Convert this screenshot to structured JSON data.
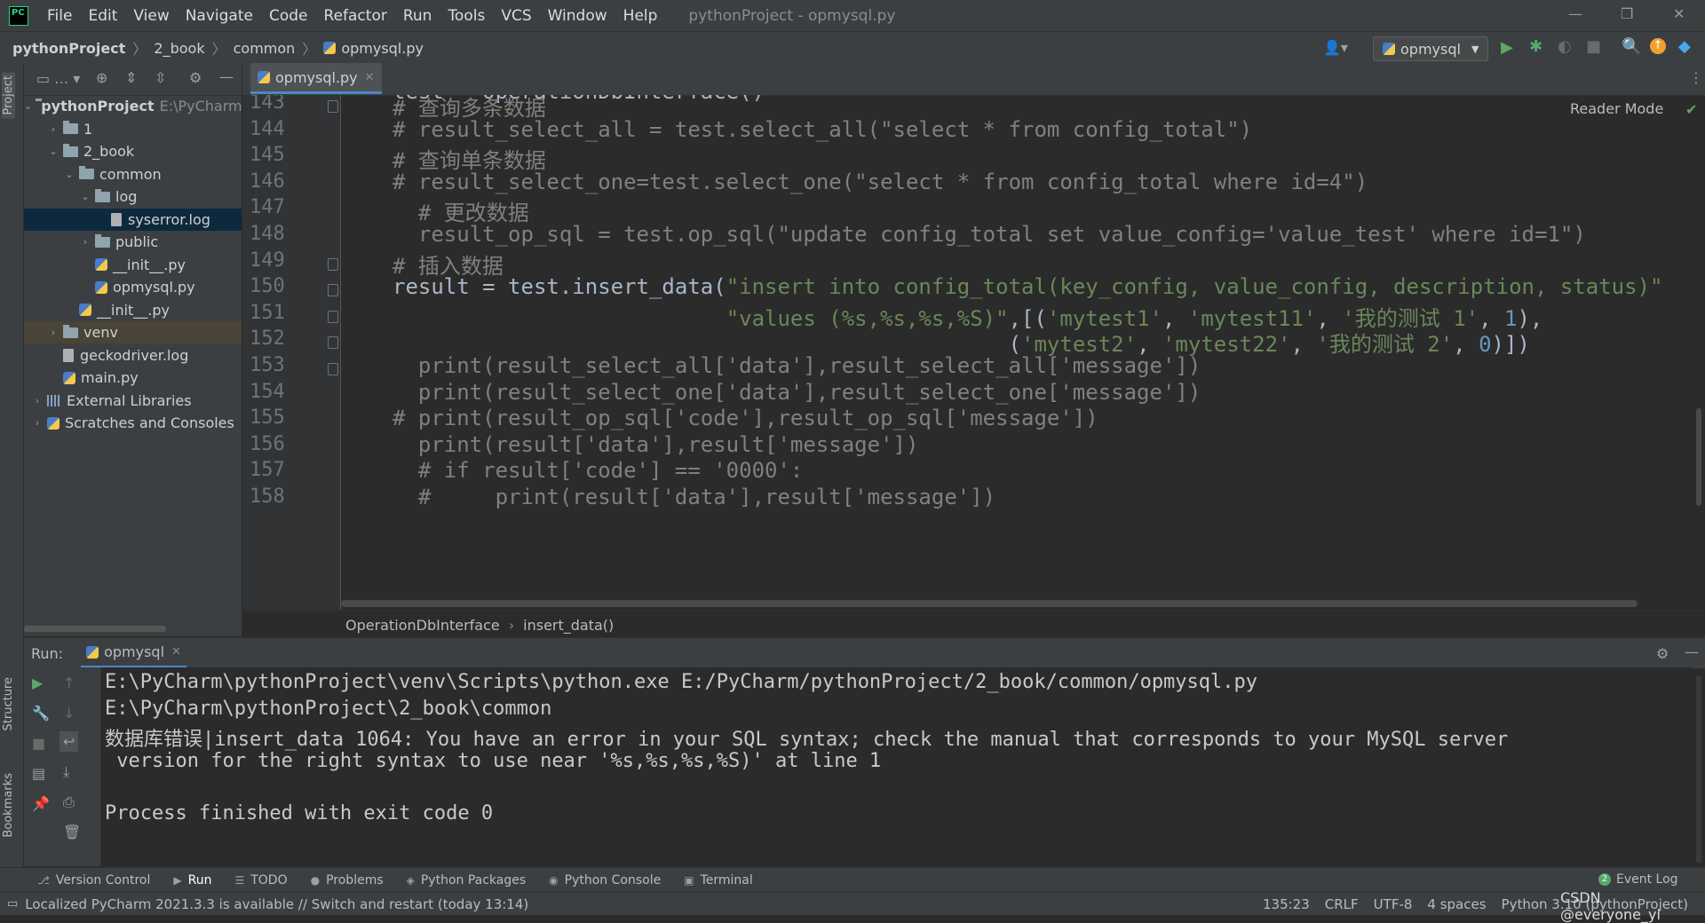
{
  "menubar": {
    "items": [
      "File",
      "Edit",
      "View",
      "Navigate",
      "Code",
      "Refactor",
      "Run",
      "Tools",
      "VCS",
      "Window",
      "Help"
    ],
    "window_title": "pythonProject - opmysql.py"
  },
  "navbar": {
    "crumbs": [
      "pythonProject",
      "2_book",
      "common",
      "opmysql.py"
    ],
    "run_config": "opmysql"
  },
  "left_strip": {
    "project_tab": "Project",
    "structure_tab": "Structure",
    "bookmarks_tab": "Bookmarks"
  },
  "project_tree": [
    {
      "label": "pythonProject",
      "hint": "E:\\PyCharm",
      "indent": 0,
      "arrow": "down",
      "icon": "folder",
      "bold": true
    },
    {
      "label": "1",
      "indent": 1,
      "arrow": "right",
      "icon": "folder"
    },
    {
      "label": "2_book",
      "indent": 1,
      "arrow": "down",
      "icon": "folder"
    },
    {
      "label": "common",
      "indent": 2,
      "arrow": "down",
      "icon": "folder"
    },
    {
      "label": "log",
      "indent": 3,
      "arrow": "down",
      "icon": "folder"
    },
    {
      "label": "syserror.log",
      "indent": 4,
      "arrow": "",
      "icon": "log",
      "selected": true
    },
    {
      "label": "public",
      "indent": 3,
      "arrow": "right",
      "icon": "folder"
    },
    {
      "label": "__init__.py",
      "indent": 3,
      "arrow": "",
      "icon": "py"
    },
    {
      "label": "opmysql.py",
      "indent": 3,
      "arrow": "",
      "icon": "py"
    },
    {
      "label": "__init__.py",
      "indent": 2,
      "arrow": "",
      "icon": "py"
    },
    {
      "label": "venv",
      "indent": 1,
      "arrow": "right",
      "icon": "folder",
      "highlight": true
    },
    {
      "label": "geckodriver.log",
      "indent": 1,
      "arrow": "",
      "icon": "log"
    },
    {
      "label": "main.py",
      "indent": 1,
      "arrow": "",
      "icon": "py"
    },
    {
      "label": "External Libraries",
      "indent": 0,
      "arrow": "right",
      "icon": "lib"
    },
    {
      "label": "Scratches and Consoles",
      "indent": 0,
      "arrow": "right",
      "icon": "scratch"
    }
  ],
  "editor": {
    "tab_label": "opmysql.py",
    "reader_mode": "Reader Mode",
    "partial_top_line": "test = OperationDbInterface()",
    "lines": [
      {
        "num": "143",
        "hash": "",
        "parts": [
          {
            "t": "# 查询多条数据",
            "c": "com"
          }
        ]
      },
      {
        "num": "144",
        "hash": "",
        "parts": [
          {
            "t": "# result_select_all = test.select_all(\"select * from config_total\")",
            "c": "com"
          }
        ]
      },
      {
        "num": "145",
        "hash": "",
        "parts": [
          {
            "t": "# 查询单条数据",
            "c": "com"
          }
        ]
      },
      {
        "num": "146",
        "hash": "",
        "parts": [
          {
            "t": "# result_select_one=test.select_one(\"select * from config_total where id=4\")",
            "c": "com"
          }
        ]
      },
      {
        "num": "147",
        "hash": "#",
        "parts": [
          {
            "t": "  # 更改数据",
            "c": "com"
          }
        ]
      },
      {
        "num": "148",
        "hash": "#",
        "parts": [
          {
            "t": "  result_op_sql = test.op_sql(\"update config_total set value_config='value_test' where id=1\")",
            "c": "com"
          }
        ]
      },
      {
        "num": "149",
        "hash": "",
        "parts": [
          {
            "t": "# 插入数据",
            "c": "com"
          }
        ]
      },
      {
        "num": "150",
        "hash": "",
        "parts": [
          {
            "t": "result = test.insert_data(",
            "c": "var"
          },
          {
            "t": "\"insert into config_total(key_config, value_config, description, status)\"",
            "c": "str"
          }
        ]
      },
      {
        "num": "151",
        "hash": "",
        "parts": [
          {
            "t": "                          ",
            "c": "var"
          },
          {
            "t": "\"values (%s,%s,%s,%S)\"",
            "c": "str"
          },
          {
            "t": ",[(",
            "c": "var"
          },
          {
            "t": "'mytest1'",
            "c": "str"
          },
          {
            "t": ", ",
            "c": "var"
          },
          {
            "t": "'mytest11'",
            "c": "str"
          },
          {
            "t": ", ",
            "c": "var"
          },
          {
            "t": "'我的测试 1'",
            "c": "str"
          },
          {
            "t": ", ",
            "c": "var"
          },
          {
            "t": "1",
            "c": "num"
          },
          {
            "t": "),",
            "c": "var"
          }
        ]
      },
      {
        "num": "152",
        "hash": "",
        "parts": [
          {
            "t": "                                                ",
            "c": "var"
          },
          {
            "t": "(",
            "c": "var"
          },
          {
            "t": "'mytest2'",
            "c": "str"
          },
          {
            "t": ", ",
            "c": "var"
          },
          {
            "t": "'mytest22'",
            "c": "str"
          },
          {
            "t": ", ",
            "c": "var"
          },
          {
            "t": "'我的测试 2'",
            "c": "str"
          },
          {
            "t": ", ",
            "c": "var"
          },
          {
            "t": "0",
            "c": "num"
          },
          {
            "t": ")])",
            "c": "var"
          }
        ]
      },
      {
        "num": "153",
        "hash": "#",
        "parts": [
          {
            "t": "  print(result_select_all['data'],result_select_all['message'])",
            "c": "com"
          }
        ]
      },
      {
        "num": "154",
        "hash": "#",
        "parts": [
          {
            "t": "  print(result_select_one['data'],result_select_one['message'])",
            "c": "com"
          }
        ]
      },
      {
        "num": "155",
        "hash": "",
        "parts": [
          {
            "t": "# print(result_op_sql['code'],result_op_sql['message'])",
            "c": "com"
          }
        ]
      },
      {
        "num": "156",
        "hash": "#",
        "parts": [
          {
            "t": "  print(result['data'],result['message'])",
            "c": "com"
          }
        ]
      },
      {
        "num": "157",
        "hash": "#",
        "parts": [
          {
            "t": "  # if result['code'] == '0000':",
            "c": "com"
          }
        ]
      },
      {
        "num": "158",
        "hash": "#",
        "parts": [
          {
            "t": "  #     print(result['data'],result['message'])",
            "c": "com"
          }
        ]
      }
    ],
    "breadcrumb": [
      "OperationDbInterface",
      "insert_data()"
    ]
  },
  "run": {
    "label": "Run:",
    "tab": "opmysql",
    "console_lines": [
      "E:\\PyCharm\\pythonProject\\venv\\Scripts\\python.exe E:/PyCharm/pythonProject/2_book/common/opmysql.py",
      "E:\\PyCharm\\pythonProject\\2_book\\common",
      "数据库错误|insert_data 1064: You have an error in your SQL syntax; check the manual that corresponds to your MySQL server",
      " version for the right syntax to use near '%s,%s,%s,%S)' at line 1",
      "",
      "Process finished with exit code 0"
    ]
  },
  "bottom_tools": [
    "Version Control",
    "Run",
    "TODO",
    "Problems",
    "Python Packages",
    "Python Console",
    "Terminal"
  ],
  "event_log": {
    "count": "2",
    "label": "Event Log"
  },
  "status": {
    "message": "Localized PyCharm 2021.3.3 is available // Switch and restart (today 13:14)",
    "position": "135:23",
    "line_sep": "CRLF",
    "encoding": "UTF-8",
    "indent": "4 spaces",
    "interpreter": "Python 3.10 (pythonProject)",
    "watermark": "CSDN @everyone_yi"
  }
}
